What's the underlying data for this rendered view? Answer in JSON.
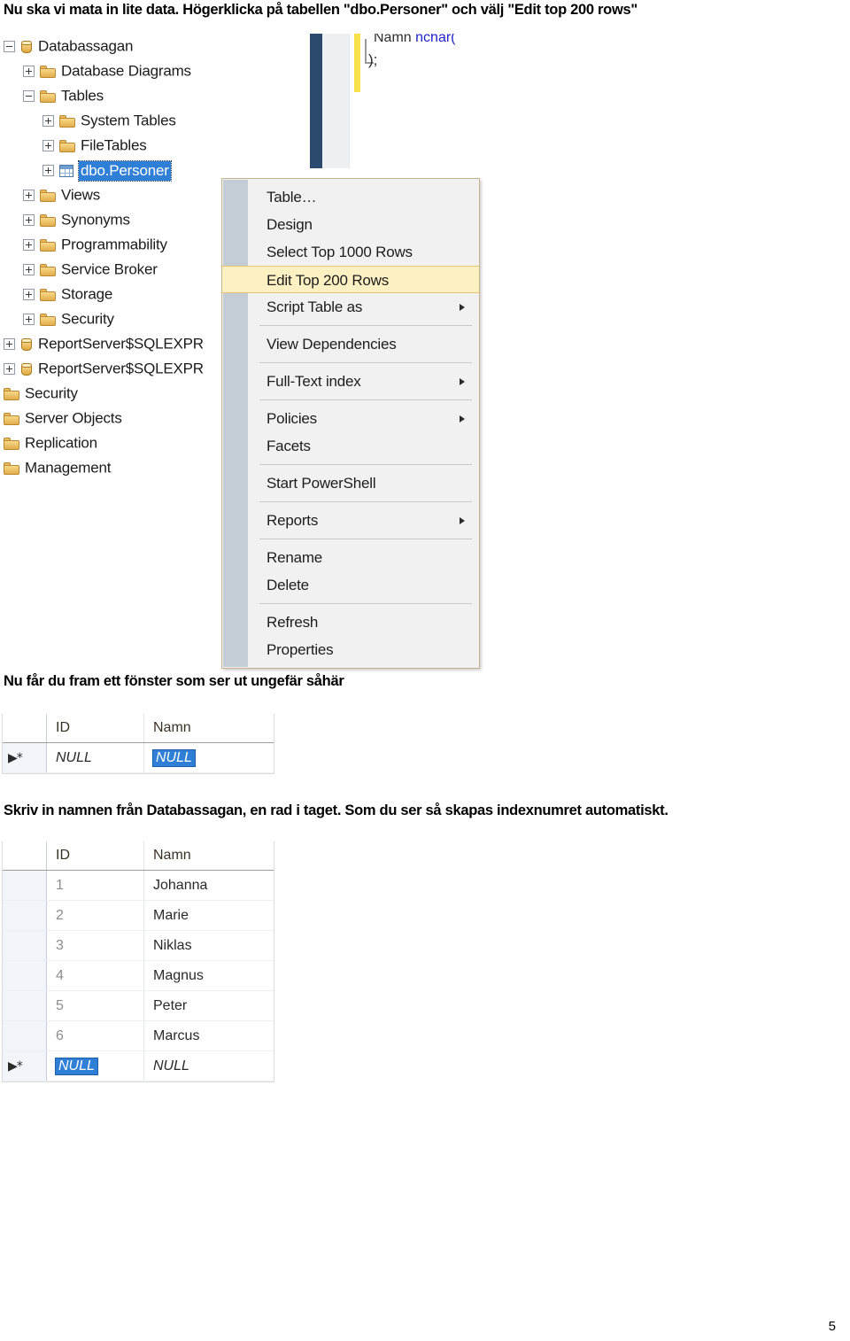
{
  "document": {
    "heading": "Nu ska vi mata in lite data. Högerklicka på tabellen \"dbo.Personer\" och välj \"Edit top 200 rows\"",
    "para_window": "Nu får du fram ett fönster som ser ut ungefär såhär",
    "para_typein": "Skriv in namnen från Databassagan, en rad i taget. Som du ser så skapas indexnumret automatiskt.",
    "page_number": "5"
  },
  "object_explorer": {
    "tree": [
      {
        "label": "Databassagan",
        "icon": "database-icon",
        "indent": 0,
        "expander": "minus",
        "selected": false
      },
      {
        "label": "Database Diagrams",
        "icon": "folder-icon",
        "indent": 1,
        "expander": "plus",
        "selected": false
      },
      {
        "label": "Tables",
        "icon": "folder-icon",
        "indent": 1,
        "expander": "minus",
        "selected": false
      },
      {
        "label": "System Tables",
        "icon": "folder-icon",
        "indent": 2,
        "expander": "plus",
        "selected": false
      },
      {
        "label": "FileTables",
        "icon": "folder-icon",
        "indent": 2,
        "expander": "plus",
        "selected": false
      },
      {
        "label": "dbo.Personer",
        "icon": "table-icon",
        "indent": 2,
        "expander": "plus",
        "selected": true
      },
      {
        "label": "Views",
        "icon": "folder-icon",
        "indent": 1,
        "expander": "plus",
        "selected": false
      },
      {
        "label": "Synonyms",
        "icon": "folder-icon",
        "indent": 1,
        "expander": "plus",
        "selected": false
      },
      {
        "label": "Programmability",
        "icon": "folder-icon",
        "indent": 1,
        "expander": "plus",
        "selected": false
      },
      {
        "label": "Service Broker",
        "icon": "folder-icon",
        "indent": 1,
        "expander": "plus",
        "selected": false
      },
      {
        "label": "Storage",
        "icon": "folder-icon",
        "indent": 1,
        "expander": "plus",
        "selected": false
      },
      {
        "label": "Security",
        "icon": "folder-icon",
        "indent": 1,
        "expander": "plus",
        "selected": false
      },
      {
        "label": "ReportServer$SQLEXPR",
        "icon": "database-icon",
        "indent": 0,
        "expander": "plus",
        "selected": false
      },
      {
        "label": "ReportServer$SQLEXPR",
        "icon": "database-icon",
        "indent": 0,
        "expander": "plus",
        "selected": false
      },
      {
        "label": "Security",
        "icon": "folder-icon",
        "indent": -1,
        "expander": "none",
        "selected": false
      },
      {
        "label": "Server Objects",
        "icon": "folder-icon",
        "indent": -1,
        "expander": "none",
        "selected": false
      },
      {
        "label": "Replication",
        "icon": "folder-icon",
        "indent": -1,
        "expander": "none",
        "selected": false
      },
      {
        "label": "Management",
        "icon": "folder-icon",
        "indent": -1,
        "expander": "none",
        "selected": false
      }
    ]
  },
  "editor_sliver": {
    "code_line_1_name": "Namn",
    "code_line_1_type": "nchar(",
    "code_line_2": ");"
  },
  "context_menu": {
    "items": [
      {
        "label": "Table…",
        "submenu": false,
        "highlighted": false,
        "separator_after": false
      },
      {
        "label": "Design",
        "submenu": false,
        "highlighted": false,
        "separator_after": false
      },
      {
        "label": "Select Top 1000 Rows",
        "submenu": false,
        "highlighted": false,
        "separator_after": false
      },
      {
        "label": "Edit Top 200 Rows",
        "submenu": false,
        "highlighted": true,
        "separator_after": false
      },
      {
        "label": "Script Table as",
        "submenu": true,
        "highlighted": false,
        "separator_after": true
      },
      {
        "label": "View Dependencies",
        "submenu": false,
        "highlighted": false,
        "separator_after": true
      },
      {
        "label": "Full-Text index",
        "submenu": true,
        "highlighted": false,
        "separator_after": true
      },
      {
        "label": "Policies",
        "submenu": true,
        "highlighted": false,
        "separator_after": false
      },
      {
        "label": "Facets",
        "submenu": false,
        "highlighted": false,
        "separator_after": true
      },
      {
        "label": "Start PowerShell",
        "submenu": false,
        "highlighted": false,
        "separator_after": true
      },
      {
        "label": "Reports",
        "submenu": true,
        "highlighted": false,
        "separator_after": true
      },
      {
        "label": "Rename",
        "submenu": false,
        "highlighted": false,
        "separator_after": false
      },
      {
        "label": "Delete",
        "submenu": false,
        "highlighted": false,
        "separator_after": true
      },
      {
        "label": "Refresh",
        "submenu": false,
        "highlighted": false,
        "separator_after": false
      },
      {
        "label": "Properties",
        "submenu": false,
        "highlighted": false,
        "separator_after": false
      }
    ]
  },
  "grid_new_row": {
    "columns": [
      "ID",
      "Namn"
    ],
    "rows": [
      {
        "marker": "▶*",
        "id": "NULL",
        "namn": "NULL",
        "id_selected": false,
        "namn_selected": true
      }
    ]
  },
  "grid_filled": {
    "columns": [
      "ID",
      "Namn"
    ],
    "rows": [
      {
        "marker": "",
        "id": "1",
        "namn": "Johanna",
        "id_selected": false,
        "namn_selected": false
      },
      {
        "marker": "",
        "id": "2",
        "namn": "Marie",
        "id_selected": false,
        "namn_selected": false
      },
      {
        "marker": "",
        "id": "3",
        "namn": "Niklas",
        "id_selected": false,
        "namn_selected": false
      },
      {
        "marker": "",
        "id": "4",
        "namn": "Magnus",
        "id_selected": false,
        "namn_selected": false
      },
      {
        "marker": "",
        "id": "5",
        "namn": "Peter",
        "id_selected": false,
        "namn_selected": false
      },
      {
        "marker": "",
        "id": "6",
        "namn": "Marcus",
        "id_selected": false,
        "namn_selected": false
      },
      {
        "marker": "▶*",
        "id": "NULL",
        "namn": "NULL",
        "id_selected": true,
        "namn_selected": false
      }
    ]
  },
  "colors": {
    "selection_blue": "#2f7fd6",
    "menu_highlight": "#fdf0c3",
    "menu_border": "#c5b38c",
    "editor_scrollbar": "#2c4a6e",
    "change_marker_yellow": "#fbe04a"
  }
}
